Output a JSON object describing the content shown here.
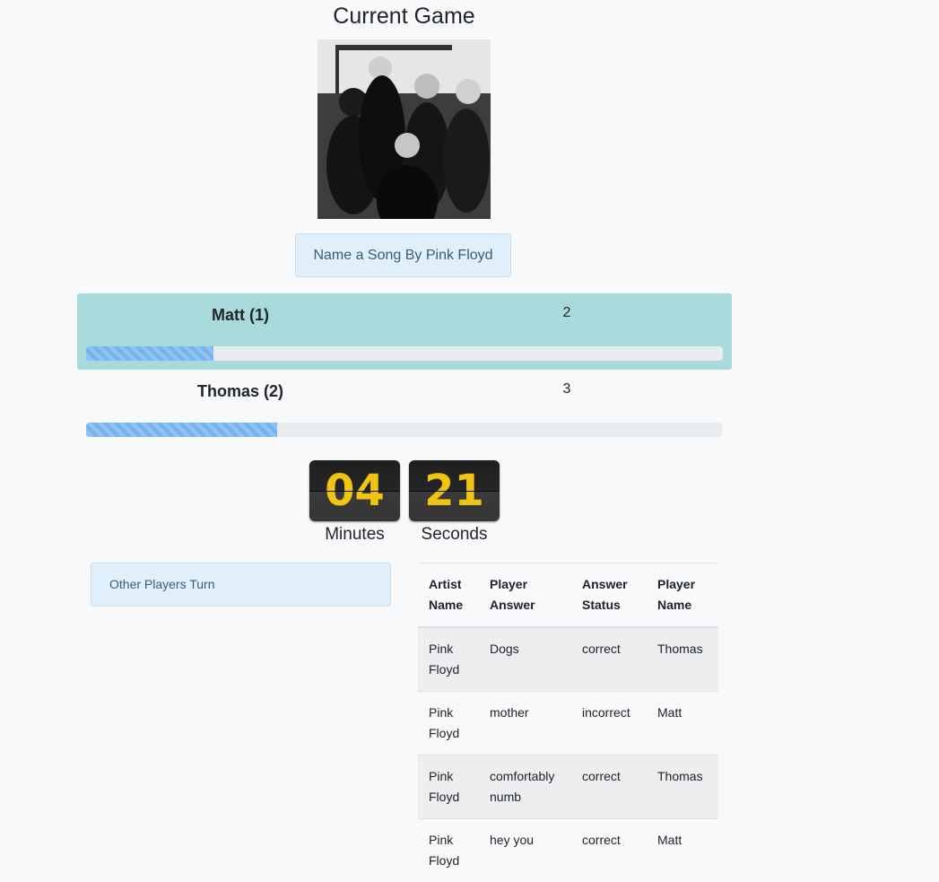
{
  "header": {
    "title": "Current Game"
  },
  "prompt": {
    "text": "Name a Song By Pink Floyd"
  },
  "players": [
    {
      "name": "Matt (1)",
      "score": "2",
      "active": true,
      "progress": 0.2
    },
    {
      "name": "Thomas (2)",
      "score": "3",
      "active": false,
      "progress": 0.3
    }
  ],
  "timer": {
    "minutes": "04",
    "seconds": "21",
    "minutes_label": "Minutes",
    "seconds_label": "Seconds",
    "digit_color": "#f1c40f"
  },
  "status": {
    "text": "Other Players Turn"
  },
  "answers": {
    "headers": [
      "Artist Name",
      "Player Answer",
      "Answer Status",
      "Player Name"
    ],
    "rows": [
      [
        "Pink Floyd",
        "Dogs",
        "correct",
        "Thomas"
      ],
      [
        "Pink Floyd",
        "mother",
        "incorrect",
        "Matt"
      ],
      [
        "Pink Floyd",
        "comfortably numb",
        "correct",
        "Thomas"
      ],
      [
        "Pink Floyd",
        "hey you",
        "correct",
        "Matt"
      ]
    ]
  },
  "colors": {
    "active_row": "#a8dadc",
    "info_bg": "#e1effa",
    "progress": "#74b3f0"
  }
}
